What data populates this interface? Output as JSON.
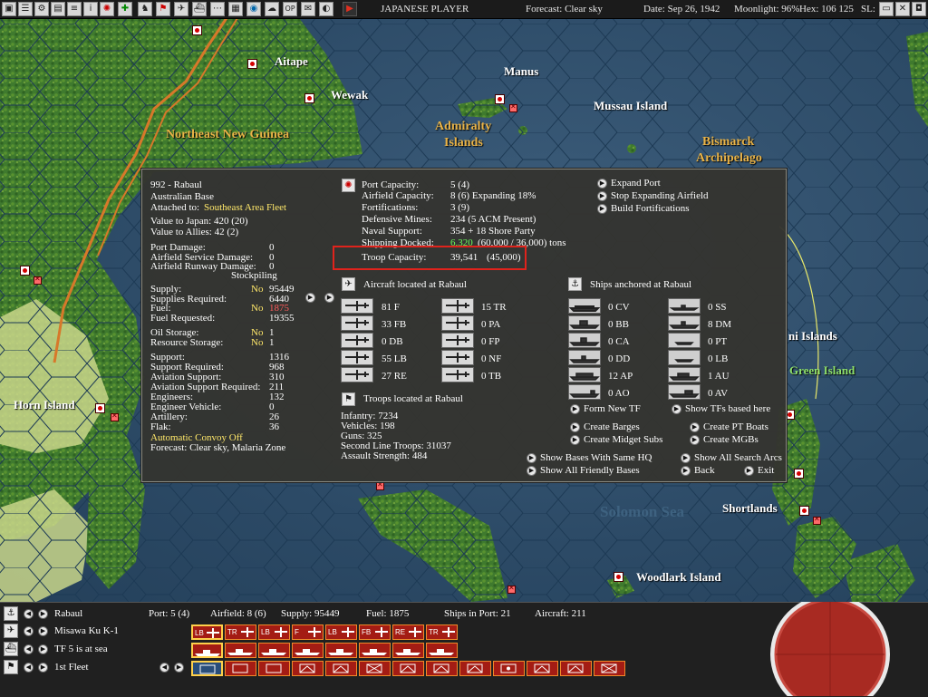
{
  "topbar": {
    "player": "JAPANESE PLAYER",
    "forecast": "Forecast: Clear sky",
    "date": "Date: Sep 26, 1942",
    "moonlight": "Moonlight: 96%",
    "hex": "Hex: 106 125",
    "sl": "SL:",
    "icons": [
      "save-icon",
      "stack-icon",
      "settings-icon",
      "report-icon",
      "info-icon",
      "japan-flag-icon",
      "target-icon",
      "troops-icon",
      "flag-icon",
      "plane-icon",
      "ship-icon",
      "tracks-icon",
      "globe-icon",
      "weather-icon",
      "op-icon",
      "mail-icon",
      "intel-icon",
      "play-icon"
    ],
    "op_label": "OP"
  },
  "map": {
    "places": [
      {
        "name": "Aitape",
        "style": "white"
      },
      {
        "name": "Wewak",
        "style": "white"
      },
      {
        "name": "Manus",
        "style": "white"
      },
      {
        "name": "Mussau Island",
        "style": "white"
      },
      {
        "name": "Admiralty",
        "style": "gold"
      },
      {
        "name": "Islands",
        "style": "gold"
      },
      {
        "name": "Northeast New Guinea",
        "style": "gold"
      },
      {
        "name": "Bismarck",
        "style": "gold"
      },
      {
        "name": "Archipelago",
        "style": "gold"
      },
      {
        "name": "ni Islands",
        "style": "white"
      },
      {
        "name": "Green Island",
        "style": "green"
      },
      {
        "name": "Horn Island",
        "style": "white"
      },
      {
        "name": "Shortlands",
        "style": "white"
      },
      {
        "name": "Woodlark Island",
        "style": "white"
      },
      {
        "name": "Solomon Sea",
        "style": "sea"
      }
    ]
  },
  "base": {
    "title": "992 - Rabaul",
    "base_type": "Australian Base",
    "attached_label": "Attached to:",
    "attached_value": "Southeast Area Fleet",
    "value_japan": "Value to Japan: 420 (20)",
    "value_allies": "Value to Allies: 42 (2)",
    "damage": [
      {
        "label": "Port Damage:",
        "value": "0"
      },
      {
        "label": "Airfield Service Damage:",
        "value": "0"
      },
      {
        "label": "Airfield Runway Damage:",
        "value": "0"
      }
    ],
    "stockpiling": "Stockpiling",
    "supply": {
      "label": "Supply:",
      "flag": "No",
      "value": "95449"
    },
    "supplies_required": {
      "label": "Supplies Required:",
      "value": "6440"
    },
    "fuel": {
      "label": "Fuel:",
      "flag": "No",
      "value": "1875"
    },
    "fuel_requested": {
      "label": "Fuel Requested:",
      "value": "19355"
    },
    "oil_storage": {
      "label": "Oil Storage:",
      "flag": "No",
      "value": "1"
    },
    "resource_storage": {
      "label": "Resource Storage:",
      "flag": "No",
      "value": "1"
    },
    "support": [
      {
        "label": "Support:",
        "value": "1316"
      },
      {
        "label": "Support Required:",
        "value": "968"
      },
      {
        "label": "Aviation Support:",
        "value": "310"
      },
      {
        "label": "Aviation Support Required:",
        "value": "211"
      },
      {
        "label": "Engineers:",
        "value": "132"
      },
      {
        "label": "Engineer Vehicle:",
        "value": "0"
      },
      {
        "label": "Artillery:",
        "value": "26"
      },
      {
        "label": "Flak:",
        "value": "36"
      }
    ],
    "convoy": "Automatic Convoy Off",
    "forecast": "Forecast: Clear sky, Malaria Zone"
  },
  "capacity": [
    {
      "label": "Port Capacity:",
      "value": "5 (4)"
    },
    {
      "label": "Airfield Capacity:",
      "value": "8 (6) Expanding 18%"
    },
    {
      "label": "Fortifications:",
      "value": "3 (9)"
    },
    {
      "label": "Defensive Mines:",
      "value": "234 (5 ACM Present)"
    },
    {
      "label": "Naval Support:",
      "value": "354 + 18 Shore Party"
    }
  ],
  "shipping_docked": {
    "label": "Shipping Docked:",
    "value": "6,320",
    "rest": "(60,000 / 36,000) tons"
  },
  "troop_capacity": {
    "label": "Troop Capacity:",
    "value": "39,541",
    "max": "(45,000)"
  },
  "actions_top": [
    "Expand Port",
    "Stop Expanding Airfield",
    "Build Fortifications"
  ],
  "aircraft": {
    "title": "Aircraft located at Rabaul",
    "left": [
      "81 F",
      "33 FB",
      "0 DB",
      "55 LB",
      "27 RE"
    ],
    "right": [
      "15 TR",
      "0 PA",
      "0 FP",
      "0 NF",
      "0 TB"
    ]
  },
  "ships": {
    "title": "Ships anchored at Rabaul",
    "left": [
      "0 CV",
      "0 BB",
      "0 CA",
      "0 DD",
      "12 AP",
      "0 AO"
    ],
    "right": [
      "0 SS",
      "8 DM",
      "0 PT",
      "0 LB",
      "1 AU",
      "0 AV"
    ]
  },
  "troops": {
    "title": "Troops located at Rabaul",
    "lines": [
      "Infantry: 7234",
      "Vehicles: 198",
      "Guns: 325",
      "Second Line Troops: 31037",
      "Assault Strength: 484"
    ]
  },
  "ship_actions": [
    [
      "Form New TF",
      "Show TFs based here"
    ],
    [
      "Create Barges",
      "Create PT Boats"
    ],
    [
      "Create Midget Subs",
      "Create MGBs"
    ]
  ],
  "footer_actions": [
    "Show Bases With Same HQ",
    "Show All Search Arcs",
    "Show All Friendly Bases",
    "Back",
    "Exit"
  ],
  "bottom": {
    "rows": [
      {
        "name": "Rabaul",
        "icon": "anchor-icon"
      },
      {
        "name": "Misawa Ku K-1",
        "icon": "plane-icon"
      },
      {
        "name": "TF 5 is at sea",
        "icon": "ship-icon"
      },
      {
        "name": "1st Fleet",
        "icon": "flag-icon"
      }
    ],
    "stats": [
      "Port: 5 (4)",
      "Airfield: 8 (6)",
      "Supply: 95449",
      "Fuel: 1875",
      "Ships in Port: 21",
      "Aircraft: 211"
    ],
    "air_tiles": [
      "LB",
      "TR",
      "LB",
      "F",
      "LB",
      "FB",
      "RE",
      "TR"
    ],
    "colors": {
      "tile": "#a41c14",
      "tile_border": "#f08a2a",
      "text_yellow": "#ffe86a",
      "highlight": "#e0231c"
    }
  }
}
